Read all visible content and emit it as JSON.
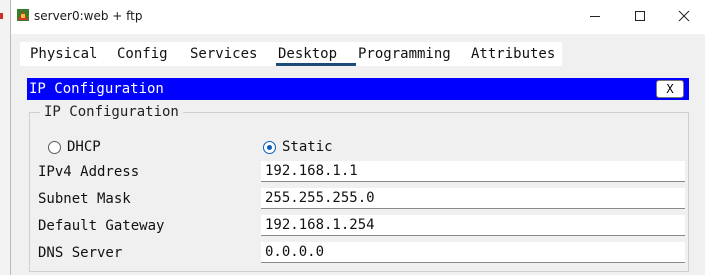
{
  "window": {
    "title": "server0:web + ftp",
    "icon": "packet-tracer-server-icon"
  },
  "tabs": [
    "Physical",
    "Config",
    "Services",
    "Desktop",
    "Programming",
    "Attributes"
  ],
  "active_tab": "Desktop",
  "ip_config": {
    "header_title": "IP Configuration",
    "close_label": "X",
    "group_legend": "IP Configuration",
    "dhcp_label": "DHCP",
    "static_label": "Static",
    "selected_mode": "Static",
    "ipv4_label": "IPv4 Address",
    "ipv4_value": "192.168.1.1",
    "subnet_label": "Subnet Mask",
    "subnet_value": "255.255.255.0",
    "gateway_label": "Default Gateway",
    "gateway_value": "192.168.1.254",
    "dns_label": "DNS Server",
    "dns_value": "0.0.0.0"
  },
  "colors": {
    "header_bg": "#0000ff",
    "tab_underline": "#1c4b79",
    "radio_accent": "#0a5cb8"
  }
}
